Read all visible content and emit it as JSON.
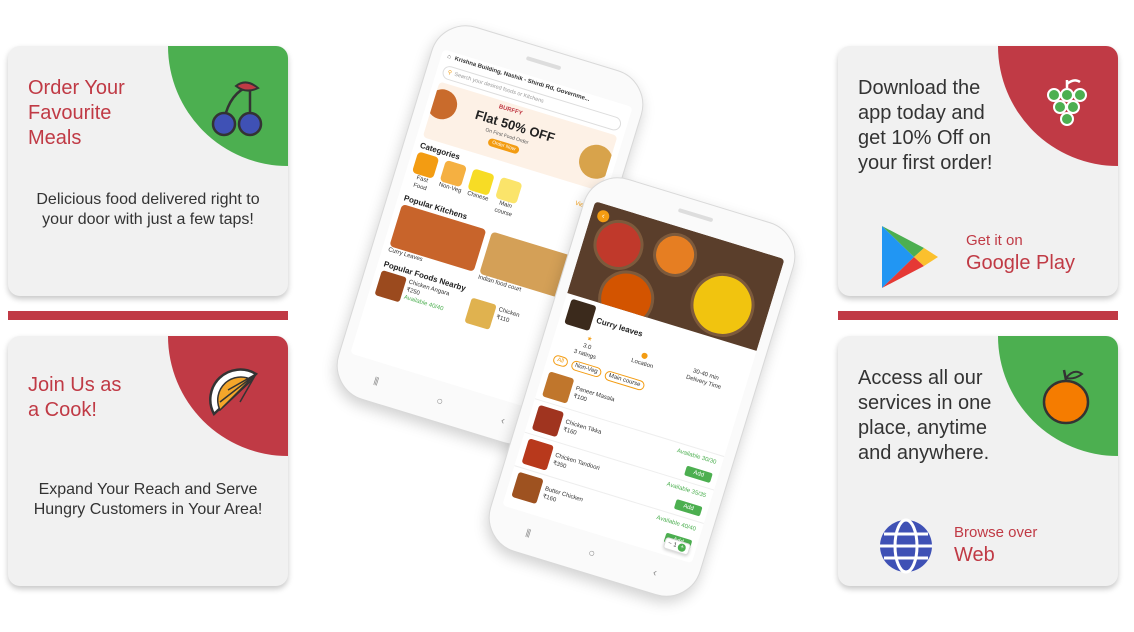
{
  "cards": {
    "order": {
      "title": "Order Your Favourite Meals",
      "desc": "Delicious food delivered right to your door with just a few taps!"
    },
    "cook": {
      "title": "Join Us as a Cook!",
      "desc": "Expand Your Reach and Serve Hungry Customers in Your Area!"
    },
    "download": {
      "title": "Download the app today and get 10% Off on your first order!",
      "store_small": "Get it on",
      "store_big": "Google Play"
    },
    "access": {
      "title": "Access all our services in one place, anytime and anywhere.",
      "web_small": "Browse over",
      "web_big": "Web"
    }
  },
  "phone_home": {
    "location": "Krishna Building, Nashik - Shirdi Rd, Governme...",
    "search_placeholder": "Search your desired foods or Kitchens",
    "banner_brand": "BURFFY",
    "banner_offer": "Flat 50% OFF",
    "banner_sub": "On First Food Order",
    "banner_cta": "Order Now",
    "categories_title": "Categories",
    "view_all": "View All",
    "categories": [
      "Fast Food",
      "Non-Veg",
      "Chinese",
      "Main course"
    ],
    "popular_kitchens_title": "Popular Kitchens",
    "kitchens": [
      "Curry Leaves",
      "Indian food court"
    ],
    "popular_foods_title": "Popular Foods Nearby",
    "foods": [
      {
        "name": "Chicken Angara",
        "price": "₹250",
        "available": "Available 40/40"
      },
      {
        "name": "Chicken",
        "price": "₹110",
        "available": ""
      }
    ]
  },
  "phone_kitchen": {
    "kitchen_name": "Curry leaves",
    "rating": "3.0",
    "ratings_label": "3 ratings",
    "location_label": "Location",
    "delivery_time": "30-40 min",
    "delivery_label": "Delivery Time",
    "filters": [
      "All",
      "Non-Veg",
      "Main course"
    ],
    "items": [
      {
        "name": "Paneer Masala",
        "price": "₹100",
        "available": "",
        "button": ""
      },
      {
        "name": "Chicken Tikka",
        "price": "₹160",
        "available": "Available 30/30",
        "button": "Add"
      },
      {
        "name": "Chicken Tandoori",
        "price": "₹350",
        "available": "Available 35/35",
        "button": "Add"
      },
      {
        "name": "Butter Chicken",
        "price": "₹160",
        "available": "Available 40/40",
        "button": "Add"
      }
    ],
    "stepper_minus": "−",
    "stepper_value": "1",
    "stepper_plus": "+",
    "available_top": "Available 40/40"
  },
  "colors": {
    "red": "#c03a45",
    "green": "#4caf50",
    "card": "#f1f1f1"
  }
}
